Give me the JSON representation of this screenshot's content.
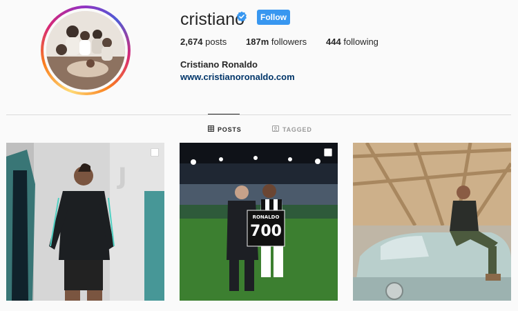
{
  "profile": {
    "username": "cristiano",
    "verified": true,
    "follow_label": "Follow",
    "posts_count": "2,674",
    "posts_label": "posts",
    "followers_count": "187m",
    "followers_label": "followers",
    "following_count": "444",
    "following_label": "following",
    "full_name": "Cristiano Ronaldo",
    "website": "www.cristianoronaldo.com"
  },
  "tabs": [
    {
      "label": "POSTS",
      "active": true,
      "icon": "grid-icon"
    },
    {
      "label": "TAGGED",
      "active": false,
      "icon": "tag-icon"
    }
  ],
  "colors": {
    "follow_button": "#3897f0",
    "verified_badge": "#3897f0",
    "link": "#003569"
  },
  "posts": [
    {
      "icon": "multiple-images-icon"
    },
    {
      "icon": "multiple-images-icon",
      "jersey_name": "RONALDO",
      "jersey_number": "700"
    },
    {}
  ]
}
